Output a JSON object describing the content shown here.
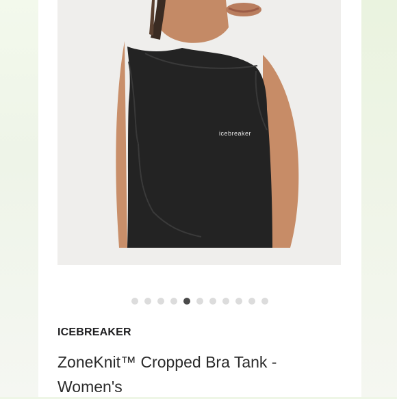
{
  "product": {
    "brand": "ICEBREAKER",
    "title": "ZoneKnit™ Cropped Bra Tank - Women's",
    "image": {
      "garment_logo": "icebreaker",
      "garment_color": "#232323",
      "background_color": "#efeeec"
    }
  },
  "carousel": {
    "total_slides": 11,
    "active_index": 4
  }
}
